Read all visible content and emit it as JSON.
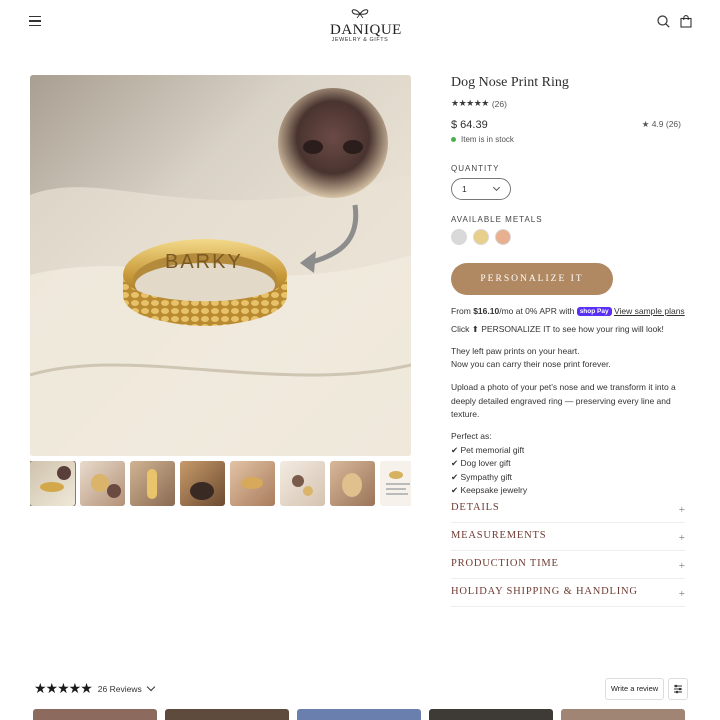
{
  "header": {
    "logo_name": "DANIQUE",
    "logo_sub": "JEWELRY & GIFTS",
    "menu_icon": "hamburger-menu-icon",
    "search_icon": "search-icon",
    "cart_icon": "shopping-bag-icon"
  },
  "gallery": {
    "engraving": "BARKY",
    "thumbnail_count": 8,
    "selected_thumbnail": 1
  },
  "product": {
    "title": "Dog Nose Print Ring",
    "stars": "★★★★★",
    "review_count": "(26)",
    "price": "$ 64.39",
    "rating_summary": "★ 4.9 (26)",
    "stock": "Item is in stock",
    "quantity_label": "QUANTITY",
    "quantity_value": "1",
    "metals_label": "AVAILABLE METALS",
    "metals": [
      {
        "name": "Silver",
        "color": "#d9d9d9"
      },
      {
        "name": "Gold",
        "color": "#e8cf8c"
      },
      {
        "name": "Rose Gold",
        "color": "#e8b08e"
      }
    ],
    "cta_label": "PERSONALIZE IT",
    "cta_color": "#b08963",
    "apr_prefix": "From ",
    "apr_amount": "$16.10",
    "apr_middle": "/mo at 0% APR with ",
    "shoppay": "shop Pay",
    "apr_link": "View sample plans",
    "click_note": "Click ⬆ PERSONALIZE IT to see how your ring will look!",
    "tagline_1": "They left paw prints on your heart.",
    "tagline_2": "Now you can carry their nose print forever.",
    "description_1": "Upload a photo of your pet’s nose and we transform it into a",
    "description_2": "deeply detailed engraved ring — preserving every line and",
    "description_3": "texture.",
    "perfect_as": "Perfect as:",
    "perfect_items": [
      "✔ Pet memorial gift",
      "✔ Dog lover gift",
      "✔ Sympathy gift",
      "✔ Keepsake jewelry"
    ]
  },
  "accordions": [
    {
      "label": "DETAILS",
      "icon": "+"
    },
    {
      "label": "MEASUREMENTS",
      "icon": "+"
    },
    {
      "label": "PRODUCTION TIME",
      "icon": "+"
    },
    {
      "label": "HOLIDAY SHIPPING & HANDLING",
      "icon": "+"
    }
  ],
  "accent_color": "#6e3b32",
  "reviews": {
    "stars": "★★★★★",
    "count_label": "26 Reviews",
    "write_label": "Write a review",
    "filter_icon": "filter-sliders-icon"
  }
}
